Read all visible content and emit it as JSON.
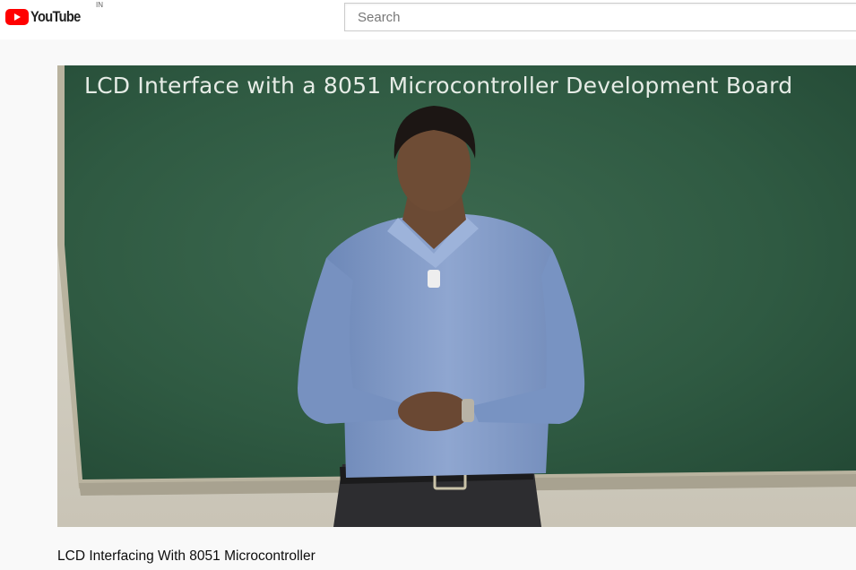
{
  "masthead": {
    "logo_text": "YouTube",
    "country_code": "IN",
    "search_placeholder": "Search"
  },
  "video": {
    "caption_on_board": "LCD Interface with a 8051 Microcontroller Development Board",
    "title": "LCD Interfacing With 8051 Microcontroller"
  },
  "colors": {
    "brand_red": "#ff0000",
    "chalkboard": "#2f5a42"
  }
}
